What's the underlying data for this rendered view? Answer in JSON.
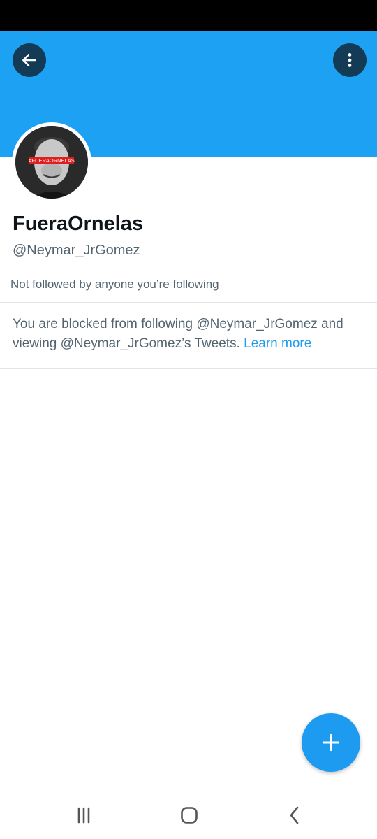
{
  "profile": {
    "display_name": "FueraOrnelas",
    "handle": "@Neymar_JrGomez",
    "avatar_banner_text": "#FUERAORNELAS",
    "followers_note": "Not followed by anyone you’re following"
  },
  "blocked_notice": {
    "text": "You are blocked from following @Neymar_JrGomez and viewing @Neymar_JrGomez’s Tweets.",
    "learn_more": "Learn more"
  },
  "header": {
    "back_icon": "arrow-left-icon",
    "more_icon": "more-vertical-icon"
  },
  "fab": {
    "icon": "plus-icon"
  },
  "system_nav": {
    "recents_icon": "recents-icon",
    "home_icon": "home-icon",
    "back_icon": "chevron-left-icon"
  },
  "colors": {
    "banner": "#1da1f2",
    "accent": "#1d9bf0",
    "text_primary": "#0f1419",
    "text_secondary": "#536471"
  }
}
